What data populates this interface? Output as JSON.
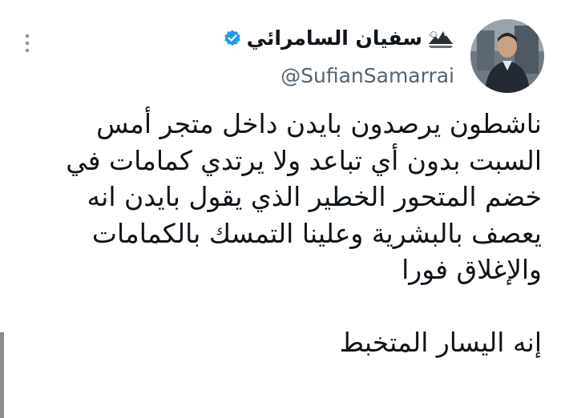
{
  "author": {
    "display_name": "سفيان السامرائي",
    "handle": "@SufianSamarrai",
    "verified": true
  },
  "tweet": {
    "lines": [
      "ناشطون يرصدون بايدن داخل متجر أمس",
      "السبت بدون أي تباعد ولا يرتدي كمامات في",
      "خضم المتحور الخطير الذي يقول بايدن انه",
      "يعصف بالبشرية وعلينا التمسك بالكمامات",
      "والإغلاق فورا"
    ],
    "closing": "إنه اليسار المتخبط"
  },
  "icons": {
    "verified": "verified-badge-icon",
    "emoji": "eagle-icon",
    "more": "more-options-icon"
  },
  "colors": {
    "verified_blue": "#1d9bf0",
    "handle_gray": "#536471",
    "text": "#0f1419"
  }
}
